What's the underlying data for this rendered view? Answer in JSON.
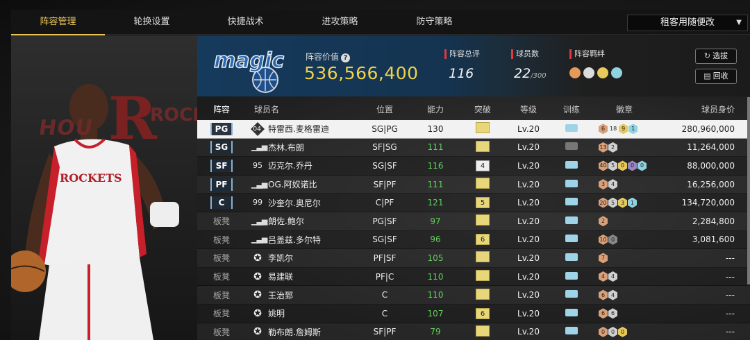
{
  "nav": {
    "tabs": [
      "阵容管理",
      "轮换设置",
      "快捷战术",
      "进攻策略",
      "防守策略"
    ],
    "active_index": 0,
    "mode_select": "租客用随便改"
  },
  "player_art": {
    "bg_text": "HOU",
    "bg_text2": "ROCK",
    "jersey": "ROCKETS"
  },
  "team": {
    "logo_text": "magic",
    "value_label": "阵容价值",
    "value": "536,566,400",
    "rating_label": "阵容总评",
    "rating": "116",
    "count_label": "球员数",
    "count": "22",
    "count_max": "/300",
    "bond_label": "阵容羁绊",
    "btn_select": "选拔",
    "btn_recycle": "回收"
  },
  "table": {
    "headers": [
      "阵容",
      "球员名",
      "位置",
      "能力",
      "突破",
      "等级",
      "训练",
      "徽章",
      "球员身价"
    ],
    "rows": [
      {
        "slot": "PG",
        "slot_type": "tag",
        "icon": "04",
        "icon_type": "jersey",
        "name": "特雷西.麦格雷迪",
        "pos": "SG|PG",
        "ovr": "130",
        "brk": "",
        "brk_type": "gold",
        "lvl": "Lv.20",
        "trn": "teal",
        "badges": [
          [
            "6",
            "b-bronze"
          ],
          [
            "18",
            "plain"
          ],
          [
            "9",
            "b-gold"
          ],
          [
            "1",
            "b-teal"
          ]
        ],
        "value": "280,960,000",
        "selected": true
      },
      {
        "slot": "SG",
        "slot_type": "tag",
        "icon": "",
        "icon_type": "signal",
        "name": "杰林.布朗",
        "pos": "SF|SG",
        "ovr": "111",
        "brk": "",
        "brk_type": "gold",
        "lvl": "Lv.20",
        "trn": "grey",
        "badges": [
          [
            "13",
            "b-bronze"
          ],
          [
            "2",
            "b-silver"
          ]
        ],
        "value": "11,264,000"
      },
      {
        "slot": "SF",
        "slot_type": "tag",
        "icon": "95",
        "icon_type": "num",
        "name": "迈克尔.乔丹",
        "pos": "SG|SF",
        "ovr": "116",
        "brk": "4",
        "brk_type": "white",
        "lvl": "Lv.20",
        "trn": "teal",
        "badges": [
          [
            "40",
            "b-bronze"
          ],
          [
            "5",
            "b-silver"
          ],
          [
            "0",
            "b-gold"
          ],
          [
            "0",
            "b-purple"
          ],
          [
            "0",
            "b-teal"
          ]
        ],
        "value": "88,000,000"
      },
      {
        "slot": "PF",
        "slot_type": "tag",
        "icon": "",
        "icon_type": "signal",
        "name": "OG.阿奴诺比",
        "pos": "SF|PF",
        "ovr": "111",
        "brk": "",
        "brk_type": "gold",
        "lvl": "Lv.20",
        "trn": "teal",
        "badges": [
          [
            "3",
            "b-bronze"
          ],
          [
            "4",
            "b-silver"
          ]
        ],
        "value": "16,256,000"
      },
      {
        "slot": "C",
        "slot_type": "tag",
        "icon": "99",
        "icon_type": "num",
        "name": "沙奎尔.奥尼尔",
        "pos": "C|PF",
        "ovr": "121",
        "brk": "5",
        "brk_type": "gold",
        "lvl": "Lv.20",
        "trn": "teal",
        "badges": [
          [
            "20",
            "b-bronze"
          ],
          [
            "5",
            "b-silver"
          ],
          [
            "3",
            "b-gold"
          ],
          [
            "1",
            "b-teal"
          ]
        ],
        "value": "134,720,000"
      },
      {
        "slot": "板凳",
        "slot_type": "bench",
        "icon": "",
        "icon_type": "signal",
        "name": "朗佐.鲍尔",
        "pos": "PG|SF",
        "ovr": "97",
        "brk": "",
        "brk_type": "gold",
        "lvl": "Lv.20",
        "trn": "teal",
        "badges": [
          [
            "2",
            "b-bronze"
          ]
        ],
        "value": "2,284,800"
      },
      {
        "slot": "板凳",
        "slot_type": "bench",
        "icon": "",
        "icon_type": "signal",
        "name": "吕盖兹.多尔特",
        "pos": "SG|SF",
        "ovr": "96",
        "brk": "6",
        "brk_type": "gold",
        "lvl": "Lv.20",
        "trn": "teal",
        "badges": [
          [
            "10",
            "b-bronze"
          ],
          [
            "0",
            "b-grey"
          ]
        ],
        "value": "3,081,600"
      },
      {
        "slot": "板凳",
        "slot_type": "bench",
        "icon": "",
        "icon_type": "star",
        "name": "李凯尔",
        "pos": "PF|SF",
        "ovr": "105",
        "brk": "",
        "brk_type": "gold",
        "lvl": "Lv.20",
        "trn": "teal",
        "badges": [
          [
            "7",
            "b-bronze"
          ]
        ],
        "value": "---"
      },
      {
        "slot": "板凳",
        "slot_type": "bench",
        "icon": "",
        "icon_type": "star",
        "name": "易建联",
        "pos": "PF|C",
        "ovr": "110",
        "brk": "",
        "brk_type": "gold",
        "lvl": "Lv.20",
        "trn": "teal",
        "badges": [
          [
            "4",
            "b-bronze"
          ],
          [
            "4",
            "b-silver"
          ]
        ],
        "value": "---"
      },
      {
        "slot": "板凳",
        "slot_type": "bench",
        "icon": "",
        "icon_type": "star",
        "name": "王治郅",
        "pos": "C",
        "ovr": "110",
        "brk": "",
        "brk_type": "gold",
        "lvl": "Lv.20",
        "trn": "teal",
        "badges": [
          [
            "6",
            "b-bronze"
          ],
          [
            "4",
            "b-silver"
          ]
        ],
        "value": "---"
      },
      {
        "slot": "板凳",
        "slot_type": "bench",
        "icon": "",
        "icon_type": "star",
        "name": "姚明",
        "pos": "C",
        "ovr": "107",
        "brk": "6",
        "brk_type": "gold",
        "lvl": "Lv.20",
        "trn": "teal",
        "badges": [
          [
            "6",
            "b-bronze"
          ],
          [
            "6",
            "b-silver"
          ]
        ],
        "value": "---"
      },
      {
        "slot": "板凳",
        "slot_type": "bench",
        "icon": "",
        "icon_type": "star",
        "name": "勒布朗.詹姆斯",
        "pos": "SF|PF",
        "ovr": "79",
        "brk": "",
        "brk_type": "gold",
        "lvl": "Lv.20",
        "trn": "teal",
        "badges": [
          [
            "0",
            "b-bronze"
          ],
          [
            "0",
            "b-silver"
          ],
          [
            "0",
            "b-gold"
          ]
        ],
        "value": "---"
      }
    ]
  },
  "colors": {
    "accent": "#e8c45a",
    "value_gold": "#f0d24a",
    "ovr_green": "#5fd35a",
    "stat_red": "#e03a3a"
  }
}
